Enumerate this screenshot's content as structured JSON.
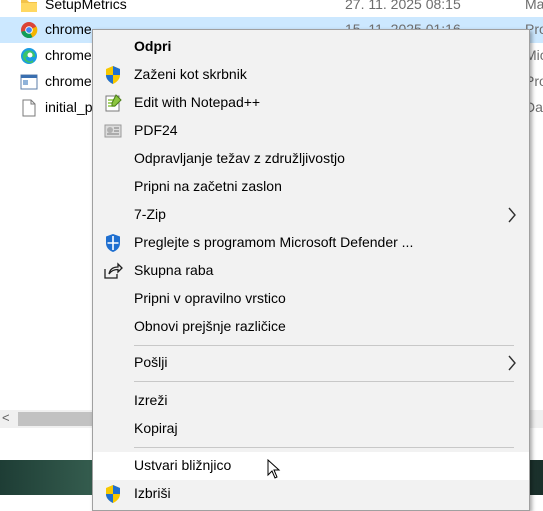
{
  "files": [
    {
      "name": "SetupMetrics",
      "date": "27. 11. 2025 08:15",
      "type": "Ma",
      "icon": "folder-icon"
    },
    {
      "name": "chrome",
      "date": "15. 11. 2025 01:16",
      "type": "Pro",
      "icon": "chrome-icon",
      "selected": true
    },
    {
      "name": "chrome",
      "date": "",
      "type": "Mic",
      "icon": "edge-icon"
    },
    {
      "name": "chrome",
      "date": "",
      "type": "Pro",
      "icon": "window-app-icon"
    },
    {
      "name": "initial_p",
      "date": "",
      "type": "Da",
      "icon": "document-icon"
    }
  ],
  "menu": {
    "open": "Odpri",
    "run_as_admin": "Zaženi kot skrbnik",
    "edit_notepad": "Edit with Notepad++",
    "pdf24": "PDF24",
    "troubleshoot": "Odpravljanje težav z združljivostjo",
    "pin_start": "Pripni na začetni zaslon",
    "zip": "7-Zip",
    "defender": "Preglejte s programom Microsoft Defender ...",
    "share": "Skupna raba",
    "pin_taskbar": "Pripni v opravilno vrstico",
    "restore": "Obnovi prejšnje različice",
    "send_to": "Pošlji",
    "cut": "Izreži",
    "copy": "Kopiraj",
    "create_shortcut": "Ustvari bližnjico",
    "delete": "Izbriši"
  },
  "scrollbar": {
    "left_arrow": "<"
  },
  "colors": {
    "selection": "#cce8ff",
    "menu_bg": "#f2f2f2",
    "shield_blue": "#1f6fd0",
    "shield_yellow": "#f6c700"
  }
}
